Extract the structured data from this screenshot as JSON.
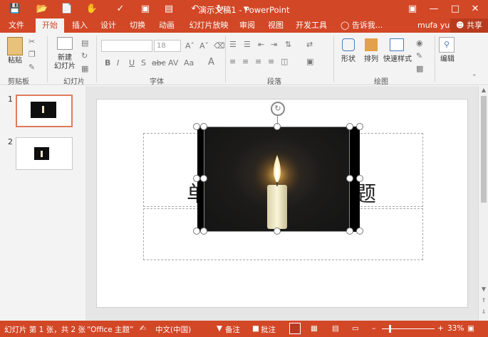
{
  "window": {
    "title": "演示文稿1 - PowerPoint",
    "qat_icons": [
      "save-icon",
      "open-folder-icon",
      "new-file-icon",
      "touch-mode-icon",
      "format-painter-icon",
      "presentation-icon",
      "slides-icon",
      "undo-icon",
      "redo-icon",
      "customize-icon"
    ],
    "controls": [
      "restore-ribbon-icon",
      "minimize-icon",
      "maximize-icon",
      "close-icon"
    ]
  },
  "tabs": {
    "file": "文件",
    "items": [
      "开始",
      "插入",
      "设计",
      "切换",
      "动画",
      "幻灯片放映",
      "审阅",
      "视图",
      "开发工具"
    ],
    "active": "开始",
    "tell_me": "告诉我...",
    "user": "mufa yu",
    "share": "共享"
  },
  "ribbon": {
    "clipboard": {
      "paste": "粘贴",
      "label": "剪贴板"
    },
    "slides": {
      "new_slide": "新建\n幻灯片",
      "label": "幻灯片"
    },
    "font": {
      "font_name": "",
      "font_size": "18",
      "label": "字体",
      "bold": "B",
      "italic": "I",
      "underline": "U",
      "strike": "S",
      "shadow": "abc",
      "aa": "Aa",
      "a": "A"
    },
    "paragraph": {
      "label": "段落"
    },
    "drawing": {
      "shape": "形状",
      "arrange": "排列",
      "quick_styles": "快速样式",
      "label": "绘图"
    },
    "editing": {
      "label": "编辑"
    }
  },
  "thumbnails": {
    "slides": [
      {
        "number": "1",
        "selected": true
      },
      {
        "number": "2",
        "selected": false
      }
    ]
  },
  "slide": {
    "title_left_char": "单",
    "title_right_char": "题"
  },
  "status": {
    "slide_info": "幻灯片 第 1 张，共 2 张",
    "theme": "“Office 主题”",
    "language": "中文(中国)",
    "notes": "备注",
    "comments": "批注",
    "zoom": "33%"
  },
  "colors": {
    "accent": "#d24726",
    "ribbon_bg": "#f3f3f3",
    "selected_thumb_border": "#e07b5e"
  }
}
